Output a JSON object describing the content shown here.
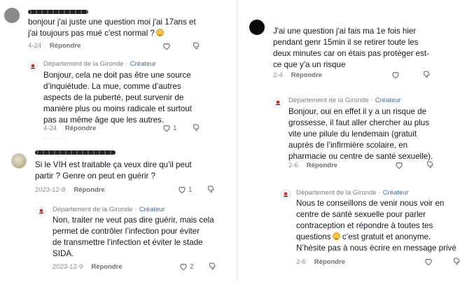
{
  "org": {
    "name": "Département de la Gironde",
    "creator_badge": "Créateur",
    "separator": "·"
  },
  "actions": {
    "reply_label": "Répondre"
  },
  "left_column": [
    {
      "kind": "comment",
      "text_lines": [
        "bonjour j'ai juste une question moi j'ai 17ans et",
        "j'ai toujours pas mué c'est normal ?"
      ],
      "date": "4-24",
      "like_count": ""
    },
    {
      "kind": "reply",
      "text_lines": [
        "Bonjour, cela ne doit pas être une source",
        "d’inquiétude. La mue, comme d’autres",
        "aspects de la puberté, peut survenir de",
        "manière plus ou moins radicale et surtout",
        "pas au même âge que les autres."
      ],
      "date": "4-24",
      "like_count": "1"
    },
    {
      "kind": "comment",
      "text_lines": [
        "Si le VIH est traitable ça veux dire qu’il peut",
        "partir ? Genre on peut en guérir ?"
      ],
      "date": "2023-12-8",
      "like_count": "1"
    },
    {
      "kind": "reply",
      "text_lines": [
        "Non, traiter ne veut pas dire guérir, mais cela",
        "permet de contrôler l’infection pour éviter",
        "de transmettre l’infection et éviter le stade",
        "SIDA."
      ],
      "date": "2023-12-9",
      "like_count": "2"
    }
  ],
  "right_column": [
    {
      "kind": "comment",
      "text_lines": [
        "J'ai une question j'ai fais ma 1e fois hier",
        "pendant genr 15min il se retirer toute les",
        "deux minutes car on étais pas protéger est-",
        "ce que y'a un risque"
      ],
      "date": "2-4",
      "like_count": ""
    },
    {
      "kind": "reply",
      "text_lines": [
        "Bonjour, oui en effet il y a un risque de",
        "grossesse, il faut aller chercher au plus",
        "vite une pilule du lendemain (gratuit",
        "auprès de l’infirmière scolaire, en",
        "pharmacie ou centre de santé sexuelle)."
      ],
      "date": "2-6",
      "like_count": ""
    },
    {
      "kind": "reply",
      "text_lines": [
        "Nous te conseillons de venir nous voir en",
        "centre de santé sexuelle pour parler",
        "contraception et répondre à toutes tes",
        "questions",
        "N’hésite pas à nous écrire en message privé"
      ],
      "inline_after_emoji": " c’est gratuit et anonyme.",
      "date": "2-6",
      "like_count": ""
    }
  ],
  "icons": {
    "like": "heart-outline-icon",
    "dislike": "thumbs-down-icon",
    "org_logo": "gironde-logo-icon",
    "emoji": "smiling-face-emoji"
  },
  "colors": {
    "creator": "#2f6fbf",
    "meta": "#8a8b91",
    "text": "#161823"
  }
}
